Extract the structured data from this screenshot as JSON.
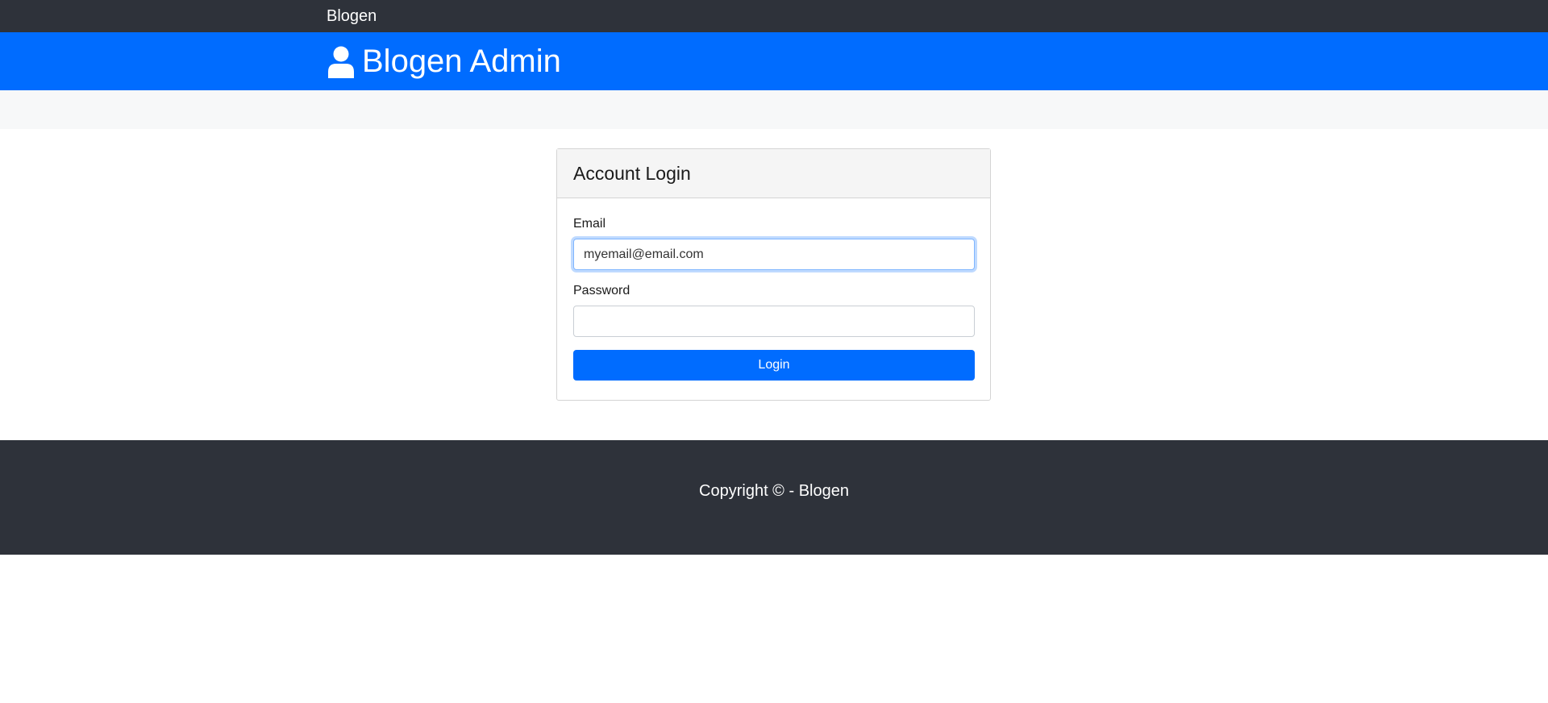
{
  "navbar": {
    "brand": "Blogen"
  },
  "header": {
    "icon": "user-icon",
    "title": "Blogen Admin"
  },
  "login": {
    "title": "Account Login",
    "email_label": "Email",
    "email_value": "myemail@email.com",
    "password_label": "Password",
    "password_value": "",
    "submit_label": "Login"
  },
  "footer": {
    "copyright": "Copyright © - Blogen"
  },
  "colors": {
    "dark": "#2e323a",
    "primary": "#006cff",
    "light_band": "#f7f8f9"
  }
}
